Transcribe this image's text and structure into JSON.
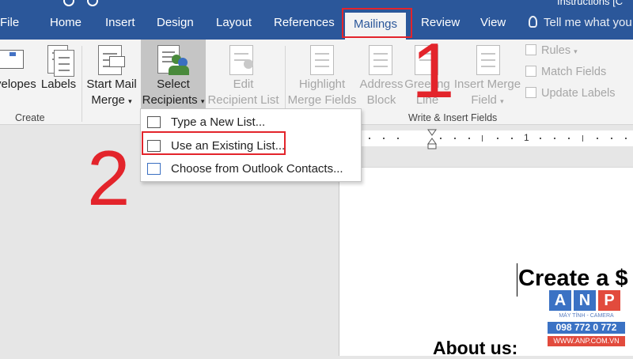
{
  "window": {
    "title": "Instructions [C"
  },
  "tabs": [
    "File",
    "Home",
    "Insert",
    "Design",
    "Layout",
    "References",
    "Mailings",
    "Review",
    "View"
  ],
  "active_tab": "Mailings",
  "tell_me": "Tell me what you",
  "ribbon": {
    "envelopes": "velopes",
    "labels": "Labels",
    "start_mail_merge_1": "Start Mail",
    "start_mail_merge_2": "Merge",
    "select_recipients_1": "Select",
    "select_recipients_2": "Recipients",
    "edit_recipient_list_1": "Edit",
    "edit_recipient_list_2": "Recipient List",
    "highlight_merge_fields_1": "Highlight",
    "highlight_merge_fields_2": "Merge Fields",
    "address_block_1": "Address",
    "address_block_2": "Block",
    "greeting_line_1": "Greeting",
    "greeting_line_2": "Line",
    "insert_merge_field_1": "Insert Merge",
    "insert_merge_field_2": "Field",
    "rules": "Rules",
    "match_fields": "Match Fields",
    "update_labels": "Update Labels",
    "group_create": "Create",
    "group_write_insert": "Write & Insert Fields"
  },
  "dropdown": {
    "type_new_list": "Type a New List...",
    "use_existing_list": "Use an Existing List...",
    "outlook_contacts": "Choose from Outlook Contacts..."
  },
  "ruler": {
    "num": "1"
  },
  "document": {
    "heading1": "Create a $",
    "heading2": "About us:"
  },
  "annotations": {
    "step1": "1",
    "step2": "2"
  },
  "watermark": {
    "a": "A",
    "n": "N",
    "p": "P",
    "tagline": "MÁY TÍNH - CAMERA",
    "phone": "098 772 0 772",
    "site": "WWW.ANP.COM.VN"
  },
  "colors": {
    "word_blue": "#2b579a",
    "annotation_red": "#e3242b"
  }
}
